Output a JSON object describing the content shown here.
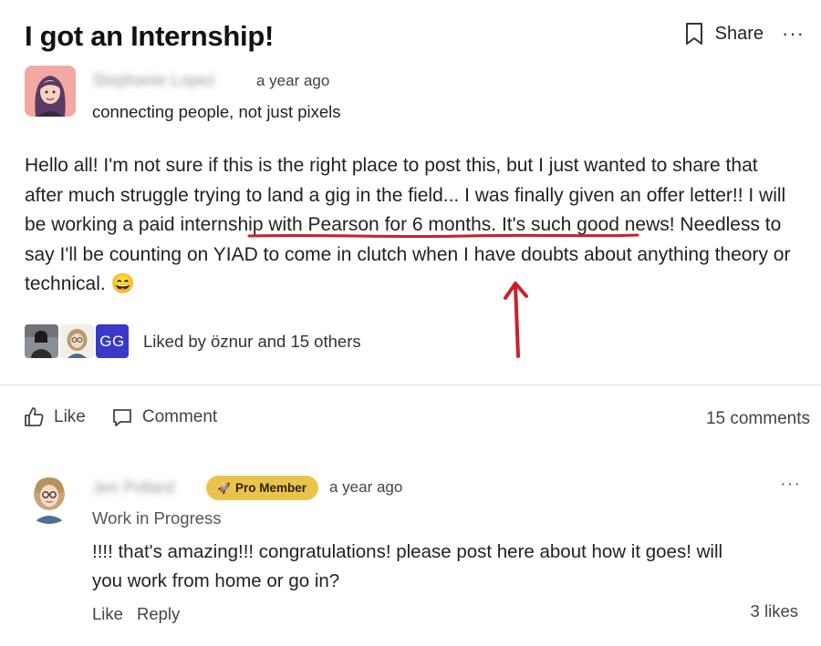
{
  "post": {
    "title": "I got an Internship!",
    "actions": {
      "share_label": "Share",
      "more_label": "···"
    },
    "author": {
      "name": "Stephanie Lopez",
      "time": "a year ago",
      "tagline": "connecting people, not just pixels"
    },
    "body": {
      "before": "Hello all! I'm not sure if this is the right place to post this, but I just wanted to share that after much struggle trying to land a gig in the field... I was finally given an offer letter!! I will be working a ",
      "highlight": "paid internship with Pearson for 6 months",
      "after": ". It's such good news! Needless to say I'll be counting on YIAD to come in clutch when I have doubts about anything theory or technical. 😄"
    },
    "likes": {
      "avatar_initials": "GG",
      "text": "Liked by öznur and 15 others"
    },
    "action_bar": {
      "like_label": "Like",
      "comment_label": "Comment",
      "comments_count": "15 comments"
    }
  },
  "comment": {
    "author_name": "Jen Pollard",
    "badge": "Pro Member",
    "time": "a year ago",
    "more_label": "···",
    "tagline": "Work in Progress",
    "text": "!!!! that's amazing!!! congratulations! please post here about how it goes! will you work from home or go in?",
    "like_label": "Like",
    "reply_label": "Reply",
    "likes_count": "3 likes"
  },
  "colors": {
    "annotation_red": "#c8202a",
    "badge_gold": "#e9c44c",
    "gg_avatar": "#3b38c8"
  }
}
